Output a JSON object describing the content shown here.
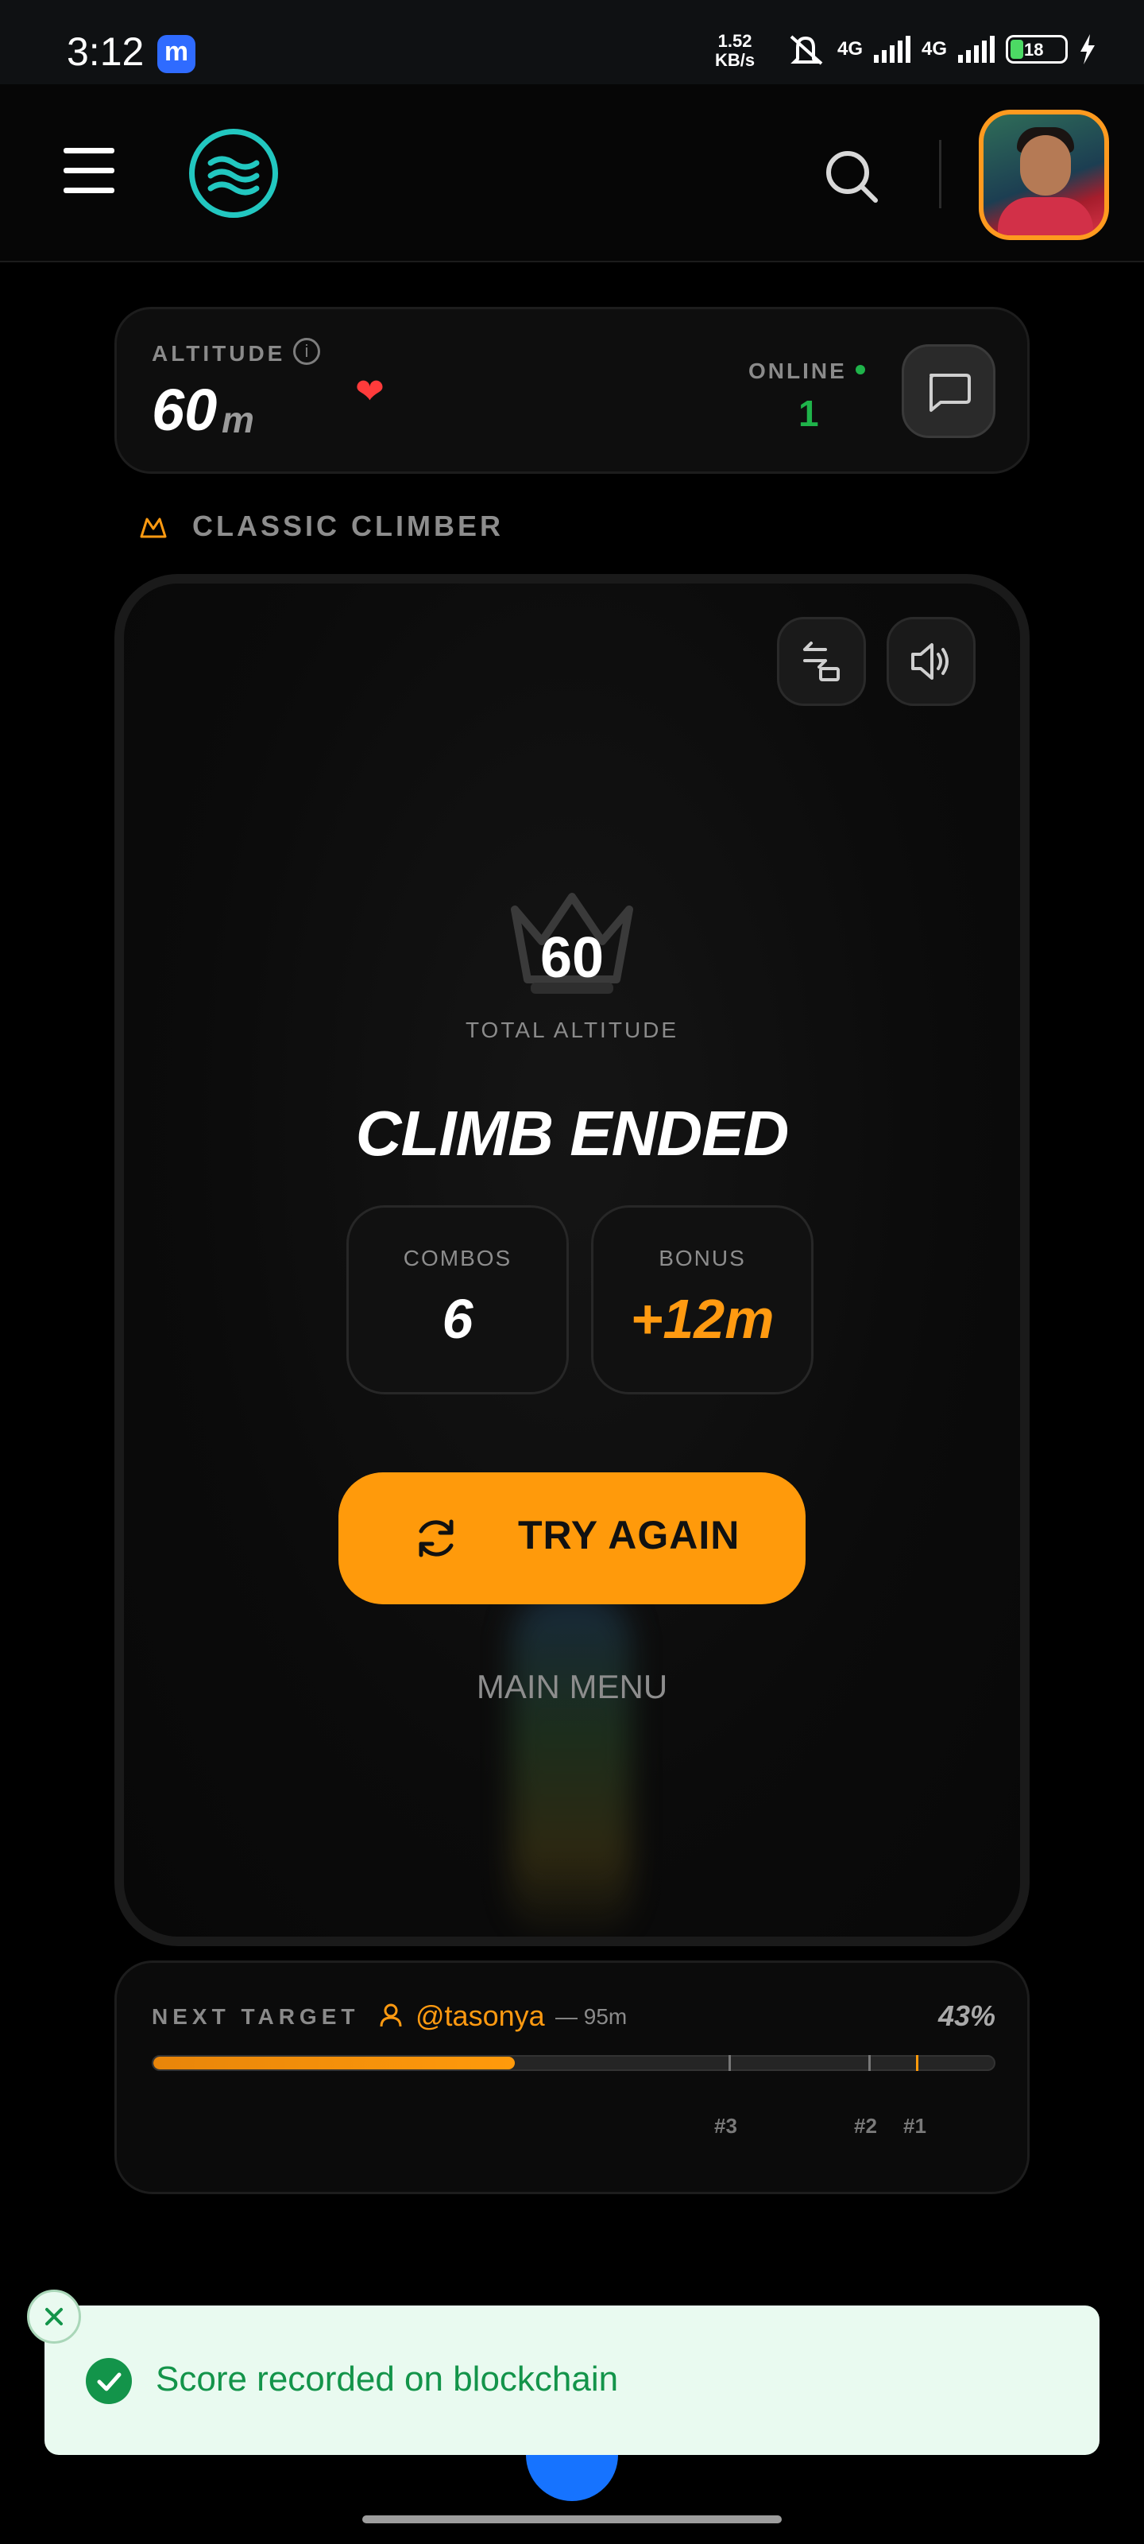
{
  "status_bar": {
    "time": "3:12",
    "speed_value": "1.52",
    "speed_unit": "KB/s",
    "network1": "4G",
    "network2": "4G",
    "battery": "18"
  },
  "header": {
    "menu_icon": "hamburger-icon",
    "logo_icon": "waves-logo-icon",
    "search_icon": "search-icon",
    "avatar": "user-avatar"
  },
  "altitude_panel": {
    "label": "ALTITUDE",
    "info": "i",
    "value": "60",
    "unit": "m",
    "online_label": "ONLINE",
    "online_count": "1",
    "online_color": "#1fb34a"
  },
  "mode": {
    "label": "CLASSIC CLIMBER"
  },
  "game": {
    "score": "60",
    "score_label": "TOTAL ALTITUDE",
    "title": "CLIMB ENDED",
    "stats": [
      {
        "label": "COMBOS",
        "value": "6"
      },
      {
        "label": "BONUS",
        "value": "+12m"
      }
    ],
    "try_again": "TRY AGAIN",
    "main_menu": "MAIN MENU",
    "accent": "#ff9a0b"
  },
  "target": {
    "label": "NEXT TARGET",
    "user": "@tasonya",
    "distance": "— 95m",
    "percent_label": "43%",
    "progress": 0.43,
    "ranks": [
      "#3",
      "#2",
      "#1"
    ]
  },
  "toast": {
    "message": "Score recorded on blockchain",
    "color": "#13944a"
  }
}
